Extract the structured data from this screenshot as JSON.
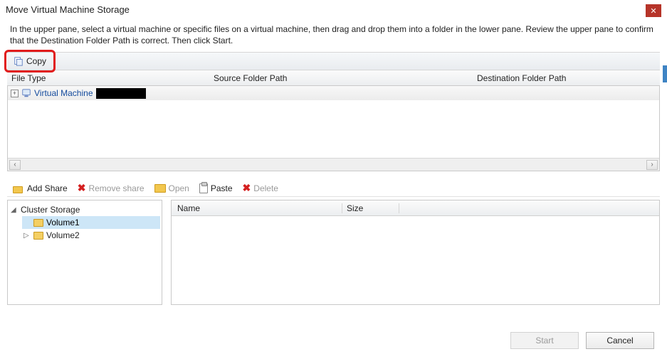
{
  "window": {
    "title": "Move Virtual Machine Storage"
  },
  "instructions": "In the upper pane, select a virtual machine or specific files on a virtual machine, then drag and drop them into a folder in the lower pane.  Review the upper pane to confirm that the Destination Folder Path is correct. Then click Start.",
  "copy_bar": {
    "copy_label": "Copy"
  },
  "upper": {
    "col_file_type": "File Type",
    "col_source": "Source Folder Path",
    "col_dest": "Destination Folder Path",
    "row_label": "Virtual Machine"
  },
  "toolbar": {
    "add_share": "Add Share",
    "remove_share": "Remove share",
    "open": "Open",
    "paste": "Paste",
    "delete": "Delete"
  },
  "tree": {
    "root": "Cluster Storage",
    "items": [
      {
        "label": "Volume1",
        "selected": true
      },
      {
        "label": "Volume2",
        "selected": false
      }
    ]
  },
  "file_list": {
    "col_name": "Name",
    "col_size": "Size"
  },
  "buttons": {
    "start": "Start",
    "cancel": "Cancel"
  }
}
